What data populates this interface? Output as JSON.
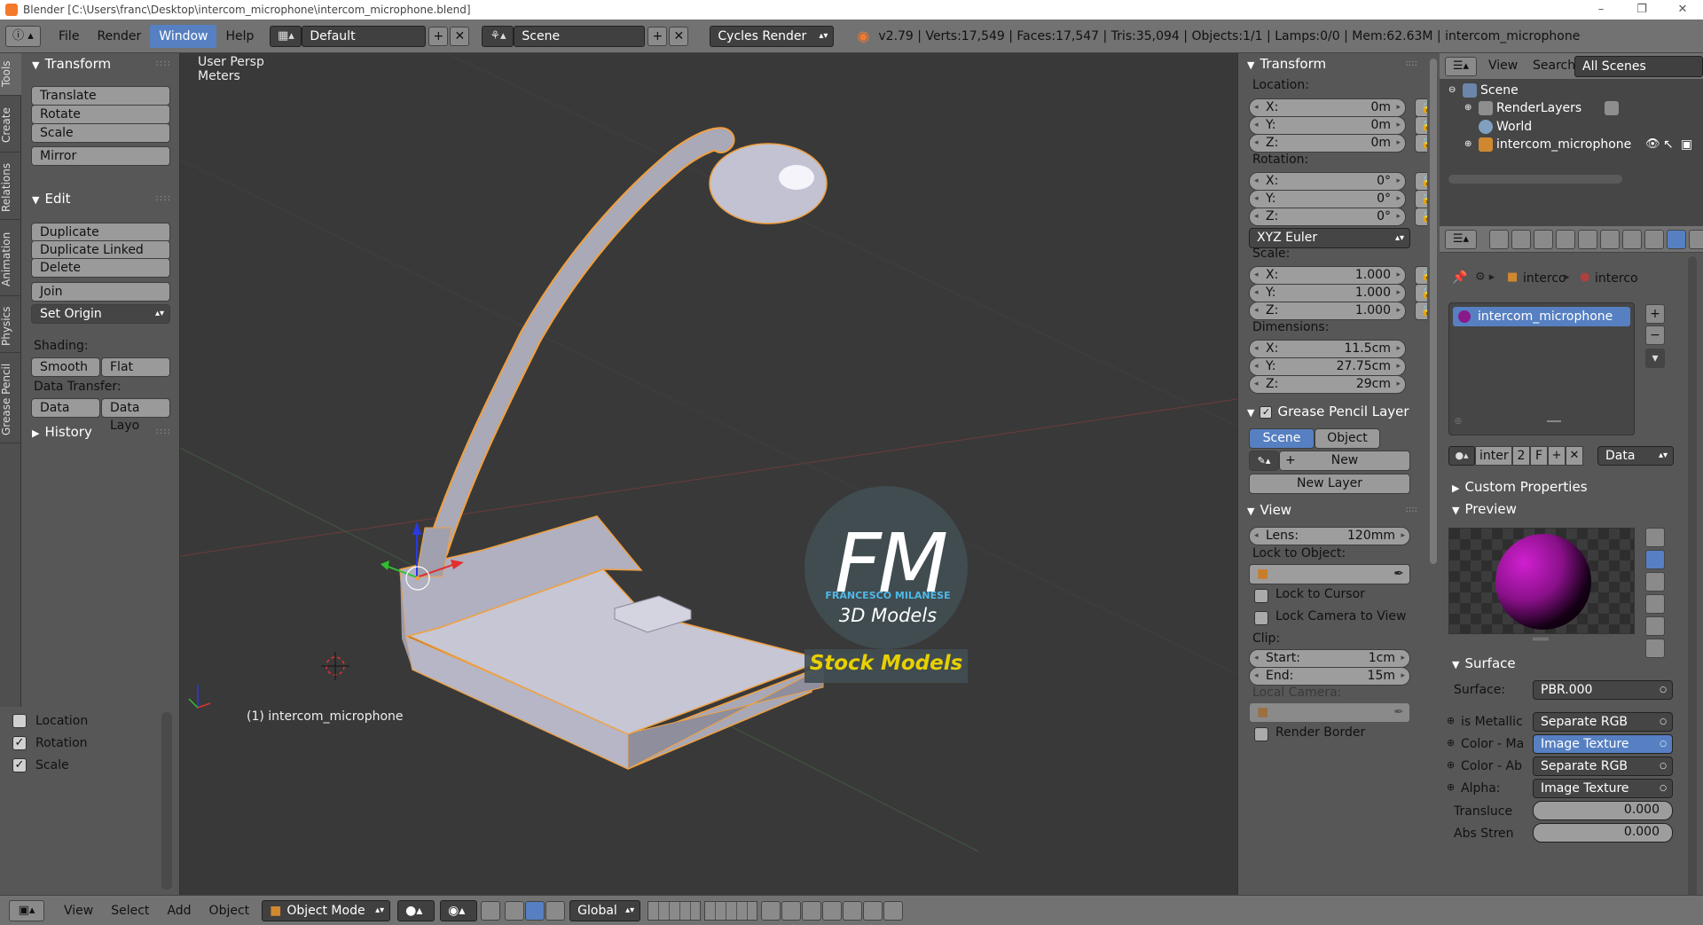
{
  "window": {
    "title": "Blender [C:\\Users\\franc\\Desktop\\intercom_microphone\\intercom_microphone.blend]",
    "controls": [
      "–",
      "❐",
      "✕"
    ]
  },
  "header": {
    "menus": [
      "File",
      "Render",
      "Window",
      "Help"
    ],
    "active_menu": "Window",
    "screen_layout": "Default",
    "scene": "Scene",
    "render_engine": "Cycles Render",
    "stats": "v2.79 | Verts:17,549 | Faces:17,547 | Tris:35,094 | Objects:1/1 | Lamps:0/0 | Mem:62.63M | intercom_microphone"
  },
  "left_tabs": [
    "Tools",
    "Create",
    "Relations",
    "Animation",
    "Physics",
    "Grease Pencil"
  ],
  "toolshelf": {
    "transform_title": "Transform",
    "translate": "Translate",
    "rotate": "Rotate",
    "scale": "Scale",
    "mirror": "Mirror",
    "edit_title": "Edit",
    "duplicate": "Duplicate",
    "duplicate_linked": "Duplicate Linked",
    "delete": "Delete",
    "join": "Join",
    "set_origin": "Set Origin",
    "shading_label": "Shading:",
    "smooth": "Smooth",
    "flat": "Flat",
    "data_transfer_label": "Data Transfer:",
    "data": "Data",
    "data_layout": "Data Layo",
    "history_title": "History"
  },
  "last_operator": {
    "location": "Location",
    "rotation": "Rotation",
    "scale": "Scale",
    "location_checked": false,
    "rotation_checked": true,
    "scale_checked": true
  },
  "viewport": {
    "view_name": "User Persp",
    "units": "Meters",
    "active_object": "(1) intercom_microphone",
    "watermark_initials": "FM",
    "watermark_name": "FRANCESCO MILANESE",
    "watermark_sub": "3D Models",
    "watermark_banner": "Stock Models"
  },
  "npanel": {
    "transform_title": "Transform",
    "location_label": "Location:",
    "location": [
      {
        "k": "X:",
        "v": "0m"
      },
      {
        "k": "Y:",
        "v": "0m"
      },
      {
        "k": "Z:",
        "v": "0m"
      }
    ],
    "rotation_label": "Rotation:",
    "rotation": [
      {
        "k": "X:",
        "v": "0°"
      },
      {
        "k": "Y:",
        "v": "0°"
      },
      {
        "k": "Z:",
        "v": "0°"
      }
    ],
    "rotation_mode": "XYZ Euler",
    "scale_label": "Scale:",
    "scale": [
      {
        "k": "X:",
        "v": "1.000"
      },
      {
        "k": "Y:",
        "v": "1.000"
      },
      {
        "k": "Z:",
        "v": "1.000"
      }
    ],
    "dimensions_label": "Dimensions:",
    "dimensions": [
      {
        "k": "X:",
        "v": "11.5cm"
      },
      {
        "k": "Y:",
        "v": "27.75cm"
      },
      {
        "k": "Z:",
        "v": "29cm"
      }
    ],
    "grease_pencil_title": "Grease Pencil Layer",
    "gp_scene": "Scene",
    "gp_object": "Object",
    "gp_new": "New",
    "gp_new_layer": "New Layer",
    "view_title": "View",
    "lens_label": "Lens:",
    "lens_value": "120mm",
    "lock_to_object": "Lock to Object:",
    "lock_to_cursor": "Lock to Cursor",
    "lock_camera": "Lock Camera to View",
    "clip_label": "Clip:",
    "clip_start_label": "Start:",
    "clip_start": "1cm",
    "clip_end_label": "End:",
    "clip_end": "15m",
    "local_camera": "Local Camera:",
    "render_border": "Render Border"
  },
  "outliner": {
    "view": "View",
    "search": "Search",
    "filter": "All Scenes",
    "items": [
      "Scene",
      "RenderLayers",
      "World",
      "intercom_microphone"
    ]
  },
  "properties": {
    "breadcrumb_obj": "interco",
    "breadcrumb_mat": "interco",
    "material_slot": "intercom_microphone",
    "mat_name": "inter",
    "mat_users": "2",
    "mat_fake": "F",
    "link_mode": "Data",
    "custom_props_title": "Custom Properties",
    "preview_title": "Preview",
    "surface_title": "Surface",
    "surface_label": "Surface:",
    "surface_value": "PBR.000",
    "inputs": [
      {
        "label": "is Metallic",
        "value": "Separate RGB",
        "active": false
      },
      {
        "label": "Color - Ma",
        "value": "Image Texture",
        "active": true
      },
      {
        "label": "Color - Ab",
        "value": "Separate RGB",
        "active": false
      },
      {
        "label": "Alpha:",
        "value": "Image Texture",
        "active": false
      }
    ],
    "translucency_label": "Transluce",
    "translucency_value": "0.000",
    "abs_strength_label": "Abs Stren",
    "abs_strength_value": "0.000"
  },
  "bottom": {
    "view": "View",
    "select": "Select",
    "add": "Add",
    "object": "Object",
    "mode": "Object Mode",
    "orientation": "Global"
  },
  "colors": {
    "accent_blue": "#5680c2",
    "selection_orange": "#f0a040",
    "watermark_yellow": "#e8d000"
  }
}
